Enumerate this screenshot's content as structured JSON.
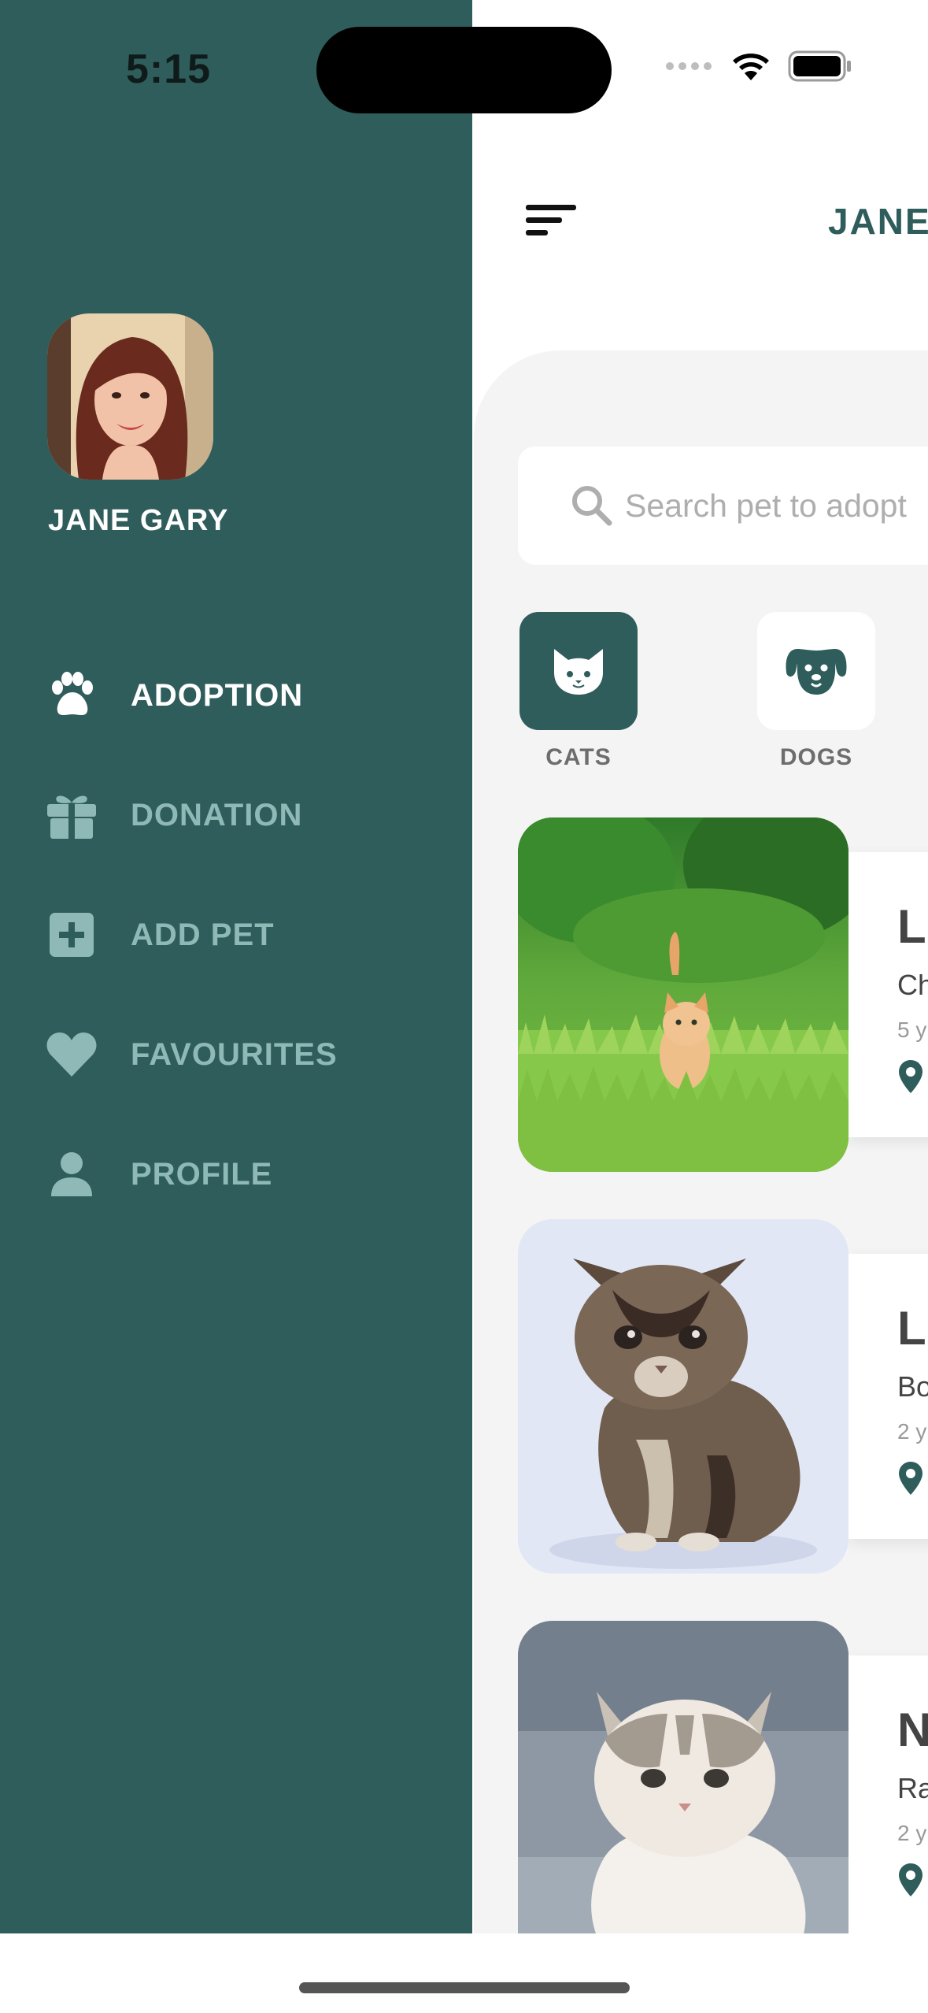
{
  "status_bar": {
    "time": "5:15"
  },
  "user": {
    "name": "JANE GARY"
  },
  "sidebar": {
    "items": [
      {
        "label": "ADOPTION",
        "icon": "paw-icon",
        "active": true
      },
      {
        "label": "DONATION",
        "icon": "gift-icon",
        "active": false
      },
      {
        "label": "ADD PET",
        "icon": "plus-square-icon",
        "active": false
      },
      {
        "label": "FAVOURITES",
        "icon": "heart-icon",
        "active": false
      },
      {
        "label": "PROFILE",
        "icon": "person-icon",
        "active": false
      }
    ]
  },
  "header": {
    "title": "JANE"
  },
  "search": {
    "placeholder": "Search pet to adopt"
  },
  "categories": [
    {
      "label": "CATS",
      "icon": "cat-icon",
      "active": true
    },
    {
      "label": "DOGS",
      "icon": "dog-icon",
      "active": false
    }
  ],
  "pets": [
    {
      "name": "Li",
      "breed": "Ch",
      "age": "5 y"
    },
    {
      "name": "Lu",
      "breed": "Bo",
      "age": "2 y"
    },
    {
      "name": "N",
      "breed": "Ra",
      "age": "2 y"
    }
  ],
  "colors": {
    "primary": "#2F5D5B",
    "sidebar_inactive": "#8FB9B6",
    "panel_bg": "#F4F4F4"
  }
}
